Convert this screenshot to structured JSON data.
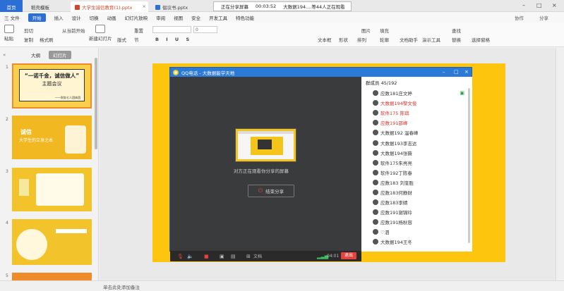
{
  "titlebar": {
    "tabs": [
      "首页",
      "稻壳模板",
      "大学生诚信教育(1).pptx",
      "倡议书.pptx"
    ],
    "share_label": "正在分享屏幕",
    "share_time": "00:03:52",
    "share_viewers": "大数据194....等44人正在观看"
  },
  "menubar": {
    "file": "三 文件",
    "start": "开始",
    "items": [
      "插入",
      "设计",
      "切换",
      "动画",
      "幻灯片放映",
      "审阅",
      "视图",
      "安全",
      "开发工具",
      "特色功能"
    ],
    "collab": "协作",
    "share": "分享"
  },
  "toolbar": {
    "paste": "粘贴",
    "cut": "剪切",
    "copy": "复制",
    "format_painter": "格式刷",
    "play_from_current": "从当前开始",
    "new_slide": "新建幻灯片",
    "layout": "版式",
    "section": "节",
    "reset": "重置",
    "font_size": "0",
    "textbox": "文本框",
    "shape": "形状",
    "arrange": "排列",
    "picture": "图片",
    "fill": "填充",
    "outline": "轮廓",
    "text_assistant": "文档助手",
    "presentation_tools": "演示工具",
    "find": "查找",
    "replace": "替换",
    "select_pane": "选择窗格"
  },
  "panel": {
    "tab_outline": "大纲",
    "tab_slides": "幻灯片",
    "slides": [
      {
        "num": "1",
        "title": "“一诺千金，诚信做人”",
        "subtitle": "主题会议",
        "author": "——财务七人团体团"
      },
      {
        "num": "2",
        "title": "诚信",
        "subtitle": "大学生的立身之本"
      },
      {
        "num": "3"
      },
      {
        "num": "4"
      },
      {
        "num": "5"
      }
    ]
  },
  "qq": {
    "title": "QQ电话 - 大数据能学天地",
    "msg": "对方正在观看你分享的屏幕",
    "end_share": "结束分享",
    "doc": "文档",
    "duration": "04:01",
    "exit": "退出",
    "members_header": "群成员 45/192",
    "members": [
      {
        "name": "应数181庄文婷",
        "hl": false,
        "screen": true
      },
      {
        "name": "大数据194黎文俊",
        "hl": true
      },
      {
        "name": "软件175 陈琪",
        "hl": true
      },
      {
        "name": "应数191邵峰",
        "hl": true
      },
      {
        "name": "大数据192 温春峰",
        "hl": false
      },
      {
        "name": "大数据193李志达",
        "hl": false
      },
      {
        "name": "大数据194张薇",
        "hl": false
      },
      {
        "name": "软件175朱亮亮",
        "hl": false
      },
      {
        "name": "软件192丁陈春",
        "hl": false
      },
      {
        "name": "应数183 刘奎胜",
        "hl": false
      },
      {
        "name": "应数183何静财",
        "hl": false
      },
      {
        "name": "应数183李婧",
        "hl": false
      },
      {
        "name": "应数191谢锦玲",
        "hl": false
      },
      {
        "name": "应数191杨秋容",
        "hl": false
      },
      {
        "name": "♡泗",
        "hl": false
      },
      {
        "name": "大数据194王冬",
        "hl": false
      }
    ]
  },
  "status": {
    "notes": "单击此处添加备注"
  },
  "colors": {
    "accent": "#2b6fd6",
    "slide_bg": "#fdc50d",
    "qq_blue": "#2b7ad8",
    "alert_red": "#e2433a"
  }
}
